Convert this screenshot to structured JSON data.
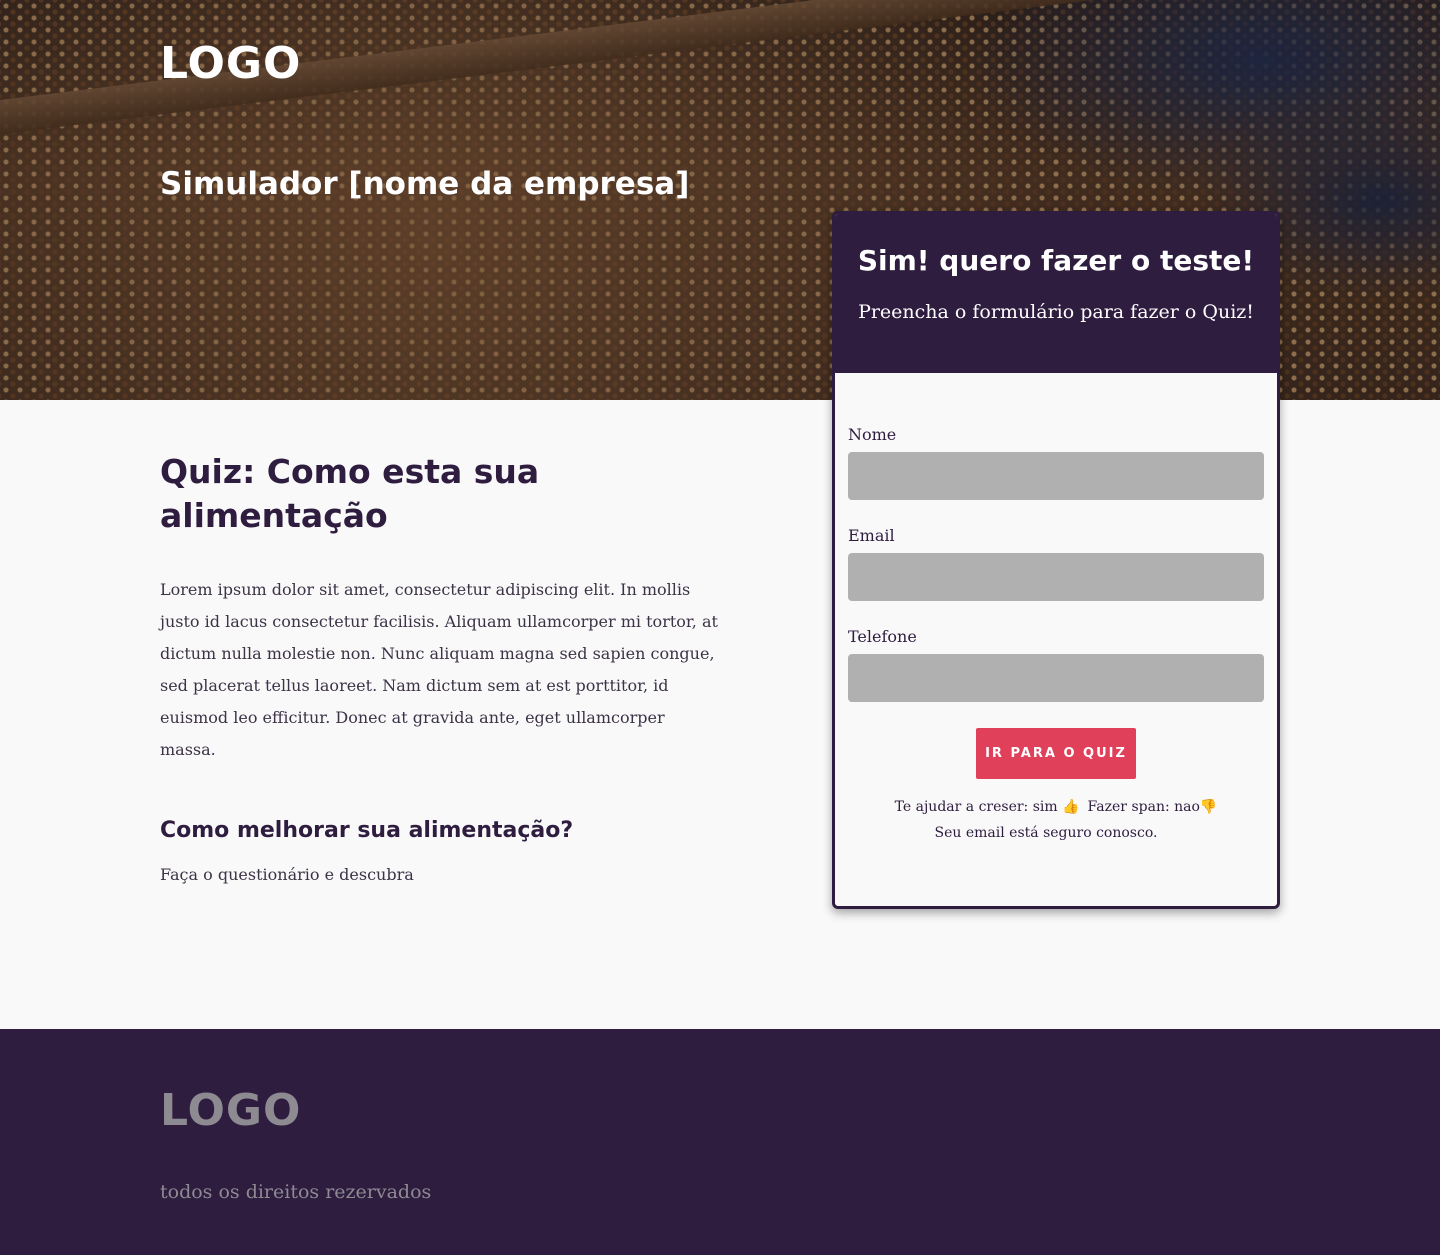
{
  "header": {
    "logo": "LOGO",
    "title": "Simulador [nome da empresa]"
  },
  "main": {
    "quiz_title": "Quiz: Como esta sua alimentação",
    "paragraph": "Lorem ipsum dolor sit amet, consectetur adipiscing elit. In mollis justo id lacus consectetur facilisis. Aliquam ullamcorper mi tortor, at dictum nulla molestie non. Nunc aliquam magna sed sapien congue, sed placerat tellus laoreet. Nam dictum sem at est porttitor, id euismod leo efficitur. Donec at gravida ante, eget ullamcorper massa.",
    "sub_heading": "Como melhorar sua alimentação?",
    "sub_text": "Faça o questionário e descubra"
  },
  "form": {
    "title": "Sim! quero fazer o teste!",
    "description": "Preencha o formulário para fazer o Quiz!",
    "fields": {
      "name_label": "Nome",
      "email_label": "Email",
      "phone_label": "Telefone"
    },
    "submit_label": "IR PARA O QUIZ",
    "note_left": "Te ajudar a creser: sim 👍",
    "note_right": "Fazer span: nao👎",
    "secure_text": "Seu email está seguro conosco."
  },
  "footer": {
    "logo": "LOGO",
    "copyright": "todos os direitos rezervados"
  },
  "colors": {
    "primary": "#2f1d40",
    "accent": "#e0405a",
    "input_bg": "#b0b0b0",
    "page_bg": "#f9f9fa"
  }
}
